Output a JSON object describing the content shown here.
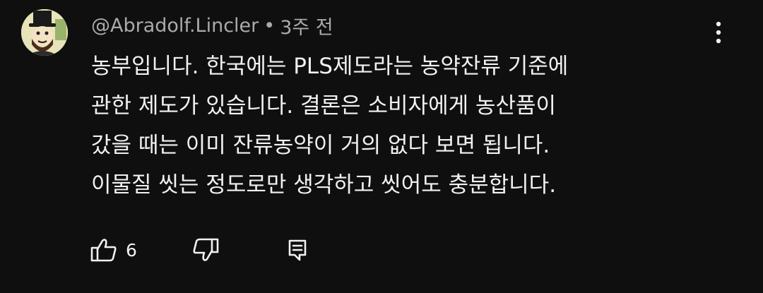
{
  "comment": {
    "author": "@Abradolf.Lincler",
    "separator": "•",
    "time_ago": "3주 전",
    "text": "농부입니다. 한국에는 PLS제도라는 농약잔류 기준에\n관한 제도가 있습니다. 결론은 소비자에게 농산품이\n갔을 때는 이미 잔류농약이 거의 없다 보면 됩니다.\n이물질 씻는 정도로만 생각하고 씻어도 충분합니다.",
    "like_count": "6"
  },
  "icons": {
    "menu": "more-vert-icon",
    "like": "thumb-up-icon",
    "dislike": "thumb-down-icon",
    "reply": "reply-comment-icon"
  },
  "colors": {
    "background": "#0f0f0f",
    "text_primary": "#f1f1f1",
    "text_secondary": "#aaaaaa"
  }
}
